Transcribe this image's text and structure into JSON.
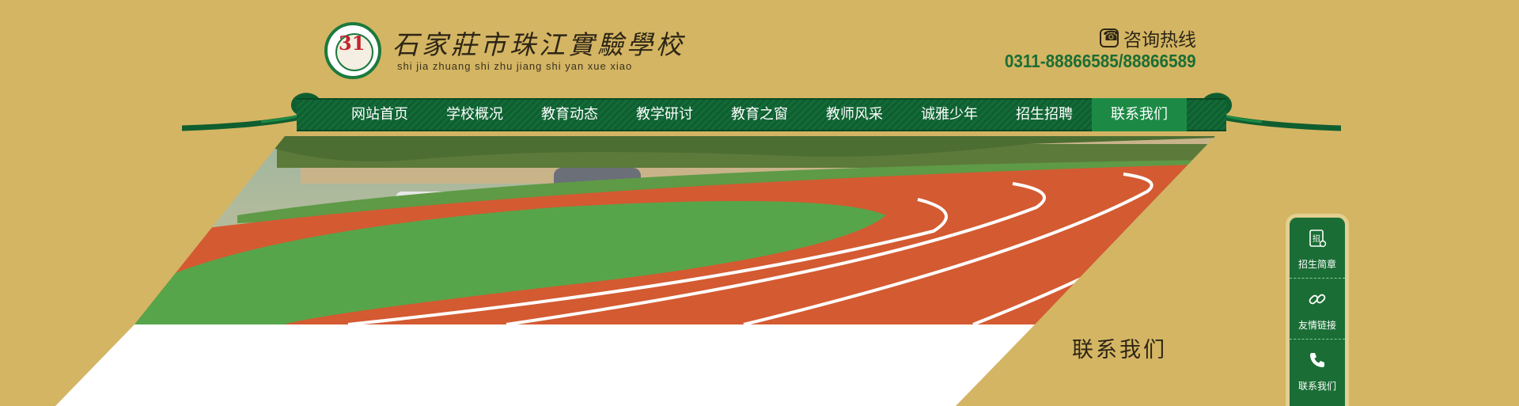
{
  "colors": {
    "background": "#d4b563",
    "nav_green": "#136b38",
    "nav_active": "#1c8a45",
    "hotline_green": "#1a6e35"
  },
  "header": {
    "logo_mark": "31",
    "school_name_cn": "石家莊市珠江實驗學校",
    "school_name_en": "shi jia zhuang shi zhu jiang shi yan xue xiao",
    "hotline_icon": "phone-icon",
    "hotline_label": "咨询热线",
    "hotline_numbers": "0311-88866585/88866589"
  },
  "nav": {
    "items": [
      {
        "label": "网站首页",
        "active": false
      },
      {
        "label": "学校概况",
        "active": false
      },
      {
        "label": "教育动态",
        "active": false
      },
      {
        "label": "教学研讨",
        "active": false
      },
      {
        "label": "教育之窗",
        "active": false
      },
      {
        "label": "教师风采",
        "active": false
      },
      {
        "label": "诚雅少年",
        "active": false
      },
      {
        "label": "招生招聘",
        "active": false
      },
      {
        "label": "联系我们",
        "active": true
      }
    ]
  },
  "banner": {
    "image": "running-track-photo"
  },
  "page": {
    "section_title": "联系我们"
  },
  "sidebar": {
    "items": [
      {
        "label": "招生简章",
        "icon": "brochure-icon"
      },
      {
        "label": "友情链接",
        "icon": "link-icon"
      },
      {
        "label": "联系我们",
        "icon": "phone-icon"
      }
    ]
  }
}
